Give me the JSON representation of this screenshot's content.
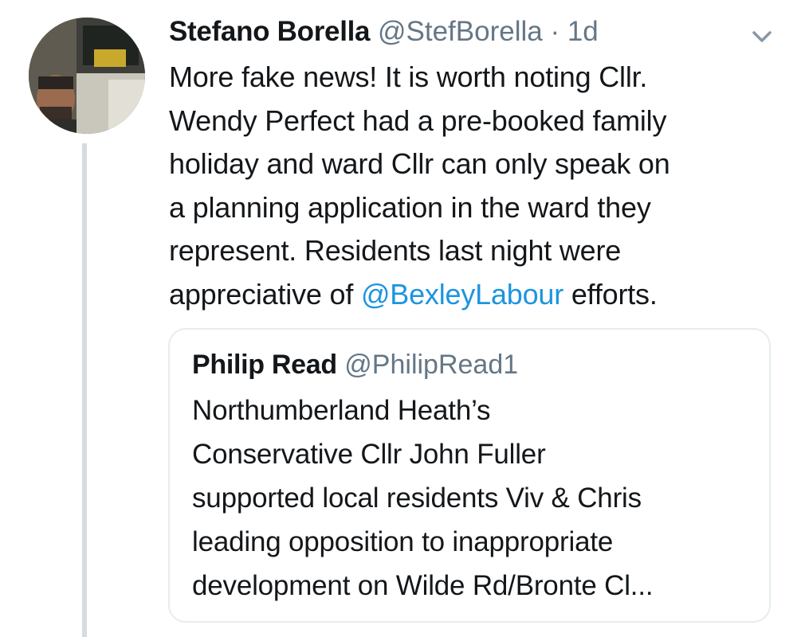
{
  "tweet": {
    "author_name": "Stefano Borella",
    "handle": "@StefBorella",
    "separator": "·",
    "time": "1d",
    "lines": [
      "More fake news! It is worth noting Cllr.",
      "Wendy Perfect had a pre-booked family",
      "holiday and ward Cllr can only speak on",
      "a planning application in the ward they",
      "represent. Residents last night were"
    ],
    "last_line": {
      "before": "appreciative of ",
      "mention": "@BexleyLabour",
      "after": " efforts."
    }
  },
  "quoted_tweet": {
    "author_name": "Philip Read",
    "handle": "@PhilipRead1",
    "lines": [
      "Northumberland Heath’s",
      "Conservative Cllr John Fuller",
      "supported local residents Viv & Chris",
      "leading opposition to inappropriate",
      "development on Wilde Rd/Bronte Cl..."
    ]
  },
  "icons": {
    "avatar": "profile-photo",
    "menu": "chevron-down-icon"
  },
  "colors": {
    "text": "#14171a",
    "secondary": "#657786",
    "link": "#1b95e0",
    "border": "#e6ecf0",
    "thread_line": "#d6dbdf"
  }
}
